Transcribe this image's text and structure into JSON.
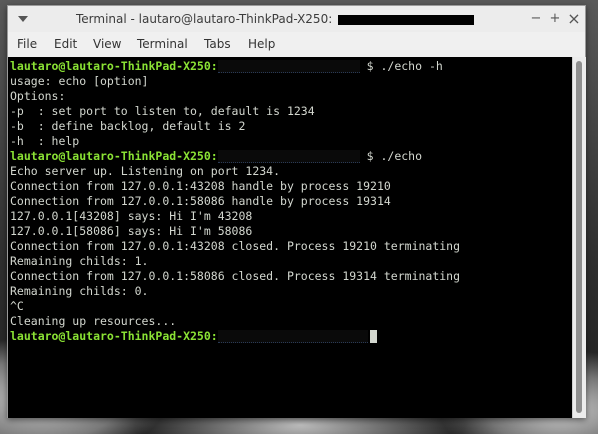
{
  "window": {
    "title": "Terminal - lautaro@lautaro-ThinkPad-X250:",
    "buttons": {
      "minimize": "−",
      "maximize": "+",
      "close": "×"
    }
  },
  "menu": [
    "File",
    "Edit",
    "View",
    "Terminal",
    "Tabs",
    "Help"
  ],
  "terminal": {
    "prompt": "lautaro@lautaro-ThinkPad-X250",
    "lines": [
      {
        "kind": "prompt",
        "cmd": "$ ./echo -h"
      },
      {
        "kind": "out",
        "text": "usage: echo [option]"
      },
      {
        "kind": "out",
        "text": "Options:"
      },
      {
        "kind": "out",
        "text": "-p  : set port to listen to, default is 1234"
      },
      {
        "kind": "out",
        "text": "-b  : define backlog, default is 2"
      },
      {
        "kind": "out",
        "text": "-h  : help"
      },
      {
        "kind": "prompt",
        "cmd": "$ ./echo"
      },
      {
        "kind": "out",
        "text": "Echo server up. Listening on port 1234."
      },
      {
        "kind": "out",
        "text": "Connection from 127.0.0.1:43208 handle by process 19210"
      },
      {
        "kind": "out",
        "text": "Connection from 127.0.0.1:58086 handle by process 19314"
      },
      {
        "kind": "out",
        "text": "127.0.0.1[43208] says: Hi I'm 43208"
      },
      {
        "kind": "out",
        "text": "127.0.0.1[58086] says: Hi I'm 58086"
      },
      {
        "kind": "out",
        "text": "Connection from 127.0.0.1:43208 closed. Process 19210 terminating"
      },
      {
        "kind": "out",
        "text": "Remaining childs: 1."
      },
      {
        "kind": "out",
        "text": "Connection from 127.0.0.1:58086 closed. Process 19314 terminating"
      },
      {
        "kind": "out",
        "text": "Remaining childs: 0."
      },
      {
        "kind": "out",
        "text": "^C"
      },
      {
        "kind": "out",
        "text": "Cleaning up resources..."
      },
      {
        "kind": "prompt",
        "cmd": ""
      }
    ]
  },
  "colors": {
    "prompt": "#8ae234",
    "text": "#d3d7cf",
    "background": "#000000"
  },
  "icons": [
    "window-menu-icon",
    "minimize-icon",
    "maximize-icon",
    "close-icon"
  ]
}
